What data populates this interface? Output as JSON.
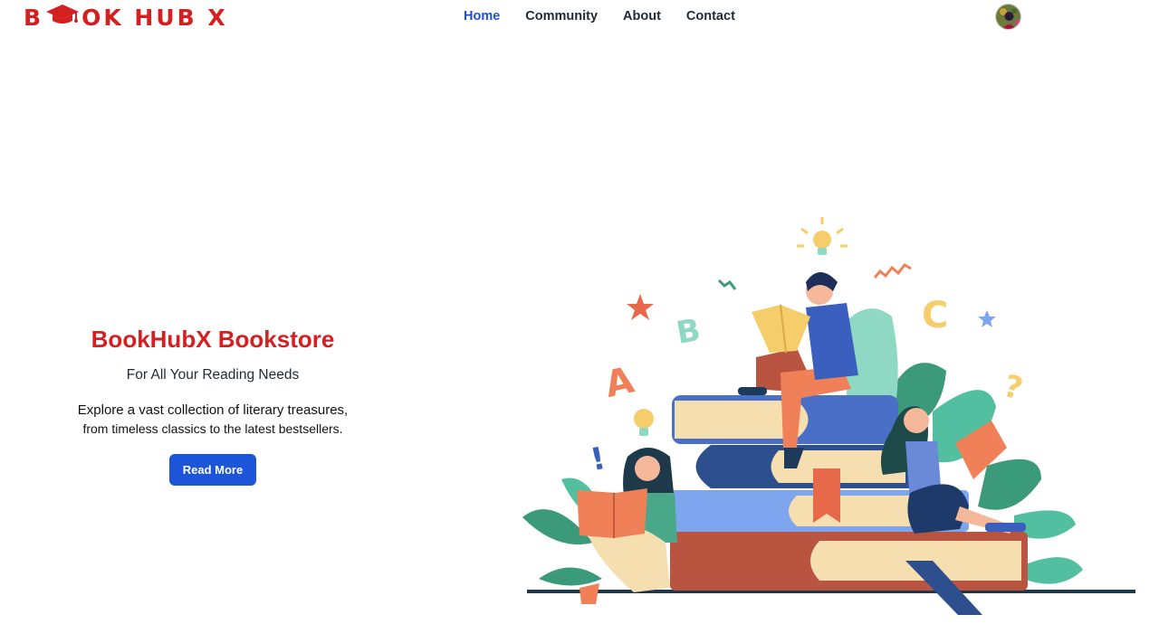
{
  "brand": {
    "name": "BOOK HUB X",
    "logo_left": "B",
    "logo_right": "OK HUB X",
    "color": "#d42020"
  },
  "nav": {
    "items": [
      {
        "label": "Home",
        "active": true
      },
      {
        "label": "Community",
        "active": false
      },
      {
        "label": "About",
        "active": false
      },
      {
        "label": "Contact",
        "active": false
      }
    ],
    "active_color": "#1d4ed8"
  },
  "hero": {
    "title": "BookHubX Bookstore",
    "subtitle": "For All Your Reading Needs",
    "description_line1": "Explore a vast collection of literary treasures,",
    "description_line2": "from timeless classics to the latest bestsellers.",
    "button_label": "Read More",
    "button_color": "#1d55d8"
  },
  "illustration": {
    "letters": [
      "A",
      "B",
      "C"
    ],
    "question_mark": "?",
    "exclamation": "!"
  }
}
